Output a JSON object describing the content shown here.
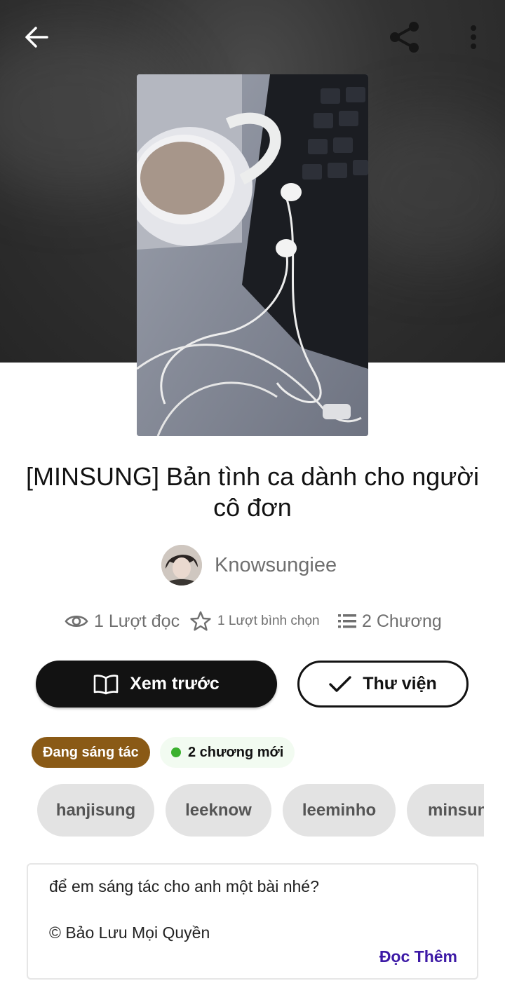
{
  "story": {
    "title": "[MINSUNG] Bản tình ca dành cho người cô đơn",
    "author": "Knowsungiee"
  },
  "stats": {
    "reads": "1 Lượt đọc",
    "votes": "1 Lượt bình chọn",
    "chapters": "2 Chương"
  },
  "actions": {
    "preview_label": "Xem trước",
    "library_label": "Thư viện"
  },
  "badges": {
    "status": "Đang sáng tác",
    "new_chapters": "2 chương mới",
    "new_dot_color": "#3bb12e",
    "status_color": "#8a5a16"
  },
  "tags": [
    "hanjisung",
    "leeknow",
    "leeminho",
    "minsung"
  ],
  "description": {
    "line1": "để em sáng tác cho anh một bài nhé?",
    "line2": "© Bảo Lưu Mọi Quyền",
    "read_more": "Đọc Thêm",
    "link_color": "#3d1aa6"
  },
  "icons": {
    "back": "arrow-left-icon",
    "share": "share-icon",
    "more": "more-vertical-icon",
    "reads": "eye-icon",
    "votes": "star-icon",
    "chapters": "list-icon",
    "preview": "book-open-icon",
    "library": "check-icon"
  }
}
